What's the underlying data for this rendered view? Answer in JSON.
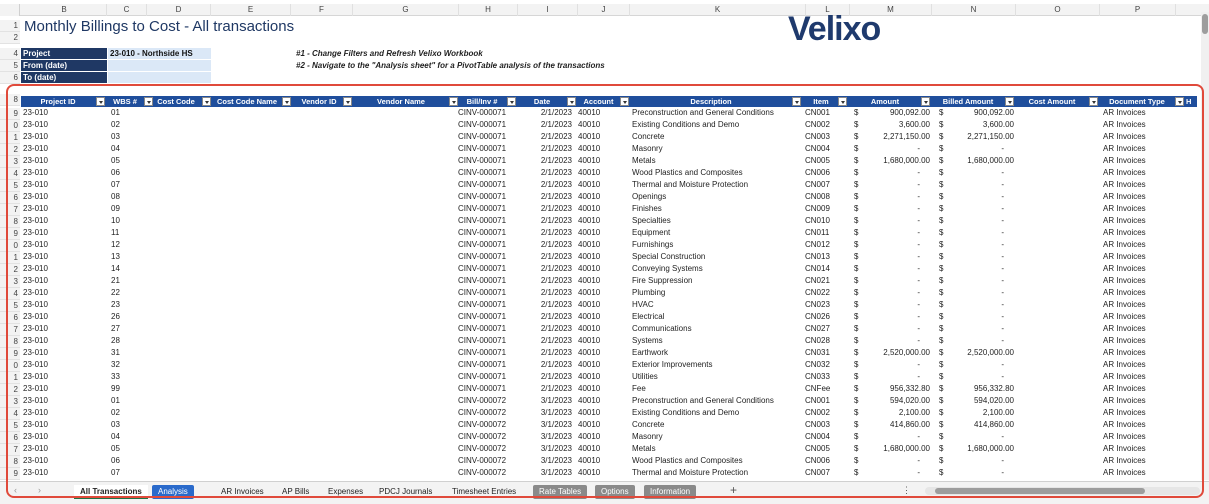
{
  "header": {
    "title": "Monthly Billings to Cost - All transactions",
    "logo": "Velixo",
    "project_label": "Project",
    "project_value": "23-010 - Northside HS",
    "from_label": "From (date)",
    "to_label": "To (date)",
    "note1": "#1 - Change Filters and Refresh Velixo Workbook",
    "note2": "#2 - Navigate to the \"Analysis sheet\" for a PivotTable analysis of the transactions"
  },
  "column_letters": [
    "B",
    "C",
    "D",
    "E",
    "F",
    "G",
    "H",
    "I",
    "J",
    "K",
    "L",
    "M",
    "N",
    "O",
    "P"
  ],
  "row_numbers": [
    "1",
    "2",
    "4",
    "5",
    "6",
    "8",
    "9",
    "0",
    "1",
    "2",
    "3",
    "4",
    "5",
    "6",
    "7",
    "8",
    "9",
    "0",
    "1",
    "2",
    "3",
    "4",
    "5",
    "6",
    "7",
    "8",
    "9",
    "0",
    "1",
    "2",
    "3",
    "4",
    "5",
    "6",
    "7",
    "8",
    "9"
  ],
  "table": {
    "headers": [
      "Project ID",
      "WBS #",
      "Cost Code",
      "Cost Code Name",
      "Vendor ID",
      "Vendor Name",
      "Bill/Inv #",
      "Date",
      "Account",
      "Description",
      "Item",
      "Amount",
      "Billed Amount",
      "Cost Amount",
      "Document Type",
      "H"
    ],
    "rows": [
      [
        "23-010",
        "01",
        "CINV-000071",
        "2/1/2023",
        "40010",
        "Preconstruction and General Conditions",
        "CN001",
        "$",
        "900,092.00",
        "$",
        "900,092.00",
        "AR Invoices"
      ],
      [
        "23-010",
        "02",
        "CINV-000071",
        "2/1/2023",
        "40010",
        "Existing Conditions and Demo",
        "CN002",
        "$",
        "3,600.00",
        "$",
        "3,600.00",
        "AR Invoices"
      ],
      [
        "23-010",
        "03",
        "CINV-000071",
        "2/1/2023",
        "40010",
        "Concrete",
        "CN003",
        "$",
        "2,271,150.00",
        "$",
        "2,271,150.00",
        "AR Invoices"
      ],
      [
        "23-010",
        "04",
        "CINV-000071",
        "2/1/2023",
        "40010",
        "Masonry",
        "CN004",
        "$",
        "-",
        "$",
        "-",
        "AR Invoices"
      ],
      [
        "23-010",
        "05",
        "CINV-000071",
        "2/1/2023",
        "40010",
        "Metals",
        "CN005",
        "$",
        "1,680,000.00",
        "$",
        "1,680,000.00",
        "AR Invoices"
      ],
      [
        "23-010",
        "06",
        "CINV-000071",
        "2/1/2023",
        "40010",
        "Wood Plastics and Composites",
        "CN006",
        "$",
        "-",
        "$",
        "-",
        "AR Invoices"
      ],
      [
        "23-010",
        "07",
        "CINV-000071",
        "2/1/2023",
        "40010",
        "Thermal and Moisture Protection",
        "CN007",
        "$",
        "-",
        "$",
        "-",
        "AR Invoices"
      ],
      [
        "23-010",
        "08",
        "CINV-000071",
        "2/1/2023",
        "40010",
        "Openings",
        "CN008",
        "$",
        "-",
        "$",
        "-",
        "AR Invoices"
      ],
      [
        "23-010",
        "09",
        "CINV-000071",
        "2/1/2023",
        "40010",
        "Finishes",
        "CN009",
        "$",
        "-",
        "$",
        "-",
        "AR Invoices"
      ],
      [
        "23-010",
        "10",
        "CINV-000071",
        "2/1/2023",
        "40010",
        "Specialties",
        "CN010",
        "$",
        "-",
        "$",
        "-",
        "AR Invoices"
      ],
      [
        "23-010",
        "11",
        "CINV-000071",
        "2/1/2023",
        "40010",
        "Equipment",
        "CN011",
        "$",
        "-",
        "$",
        "-",
        "AR Invoices"
      ],
      [
        "23-010",
        "12",
        "CINV-000071",
        "2/1/2023",
        "40010",
        "Furnishings",
        "CN012",
        "$",
        "-",
        "$",
        "-",
        "AR Invoices"
      ],
      [
        "23-010",
        "13",
        "CINV-000071",
        "2/1/2023",
        "40010",
        "Special Construction",
        "CN013",
        "$",
        "-",
        "$",
        "-",
        "AR Invoices"
      ],
      [
        "23-010",
        "14",
        "CINV-000071",
        "2/1/2023",
        "40010",
        "Conveying Systems",
        "CN014",
        "$",
        "-",
        "$",
        "-",
        "AR Invoices"
      ],
      [
        "23-010",
        "21",
        "CINV-000071",
        "2/1/2023",
        "40010",
        "Fire Suppression",
        "CN021",
        "$",
        "-",
        "$",
        "-",
        "AR Invoices"
      ],
      [
        "23-010",
        "22",
        "CINV-000071",
        "2/1/2023",
        "40010",
        "Plumbing",
        "CN022",
        "$",
        "-",
        "$",
        "-",
        "AR Invoices"
      ],
      [
        "23-010",
        "23",
        "CINV-000071",
        "2/1/2023",
        "40010",
        "HVAC",
        "CN023",
        "$",
        "-",
        "$",
        "-",
        "AR Invoices"
      ],
      [
        "23-010",
        "26",
        "CINV-000071",
        "2/1/2023",
        "40010",
        "Electrical",
        "CN026",
        "$",
        "-",
        "$",
        "-",
        "AR Invoices"
      ],
      [
        "23-010",
        "27",
        "CINV-000071",
        "2/1/2023",
        "40010",
        "Communications",
        "CN027",
        "$",
        "-",
        "$",
        "-",
        "AR Invoices"
      ],
      [
        "23-010",
        "28",
        "CINV-000071",
        "2/1/2023",
        "40010",
        "Systems",
        "CN028",
        "$",
        "-",
        "$",
        "-",
        "AR Invoices"
      ],
      [
        "23-010",
        "31",
        "CINV-000071",
        "2/1/2023",
        "40010",
        "Earthwork",
        "CN031",
        "$",
        "2,520,000.00",
        "$",
        "2,520,000.00",
        "AR Invoices"
      ],
      [
        "23-010",
        "32",
        "CINV-000071",
        "2/1/2023",
        "40010",
        "Exterior Improvements",
        "CN032",
        "$",
        "-",
        "$",
        "-",
        "AR Invoices"
      ],
      [
        "23-010",
        "33",
        "CINV-000071",
        "2/1/2023",
        "40010",
        "Utilities",
        "CN033",
        "$",
        "-",
        "$",
        "-",
        "AR Invoices"
      ],
      [
        "23-010",
        "99",
        "CINV-000071",
        "2/1/2023",
        "40010",
        "Fee",
        "CNFee",
        "$",
        "956,332.80",
        "$",
        "956,332.80",
        "AR Invoices"
      ],
      [
        "23-010",
        "01",
        "CINV-000072",
        "3/1/2023",
        "40010",
        "Preconstruction and General Conditions",
        "CN001",
        "$",
        "594,020.00",
        "$",
        "594,020.00",
        "AR Invoices"
      ],
      [
        "23-010",
        "02",
        "CINV-000072",
        "3/1/2023",
        "40010",
        "Existing Conditions and Demo",
        "CN002",
        "$",
        "2,100.00",
        "$",
        "2,100.00",
        "AR Invoices"
      ],
      [
        "23-010",
        "03",
        "CINV-000072",
        "3/1/2023",
        "40010",
        "Concrete",
        "CN003",
        "$",
        "414,860.00",
        "$",
        "414,860.00",
        "AR Invoices"
      ],
      [
        "23-010",
        "04",
        "CINV-000072",
        "3/1/2023",
        "40010",
        "Masonry",
        "CN004",
        "$",
        "-",
        "$",
        "-",
        "AR Invoices"
      ],
      [
        "23-010",
        "05",
        "CINV-000072",
        "3/1/2023",
        "40010",
        "Metals",
        "CN005",
        "$",
        "1,680,000.00",
        "$",
        "1,680,000.00",
        "AR Invoices"
      ],
      [
        "23-010",
        "06",
        "CINV-000072",
        "3/1/2023",
        "40010",
        "Wood Plastics and Composites",
        "CN006",
        "$",
        "-",
        "$",
        "-",
        "AR Invoices"
      ],
      [
        "23-010",
        "07",
        "CINV-000072",
        "3/1/2023",
        "40010",
        "Thermal and Moisture Protection",
        "CN007",
        "$",
        "-",
        "$",
        "-",
        "AR Invoices"
      ]
    ]
  },
  "tabs": [
    {
      "label": "All Transactions",
      "style": "active"
    },
    {
      "label": "Analysis",
      "style": "blue"
    },
    {
      "label": "AR Invoices",
      "style": "plain"
    },
    {
      "label": "AP Bills",
      "style": "plain"
    },
    {
      "label": "Expenses",
      "style": "plain"
    },
    {
      "label": "PDCJ Journals",
      "style": "plain"
    },
    {
      "label": "Timesheet Entries",
      "style": "plain"
    },
    {
      "label": "Rate Tables",
      "style": "grey"
    },
    {
      "label": "Options",
      "style": "grey"
    },
    {
      "label": "Information",
      "style": "grey"
    }
  ],
  "add_sheet_label": "+",
  "colors": {
    "header_blue": "#1f4e9c",
    "navy": "#1f3864",
    "highlight": "#e04a3b"
  }
}
